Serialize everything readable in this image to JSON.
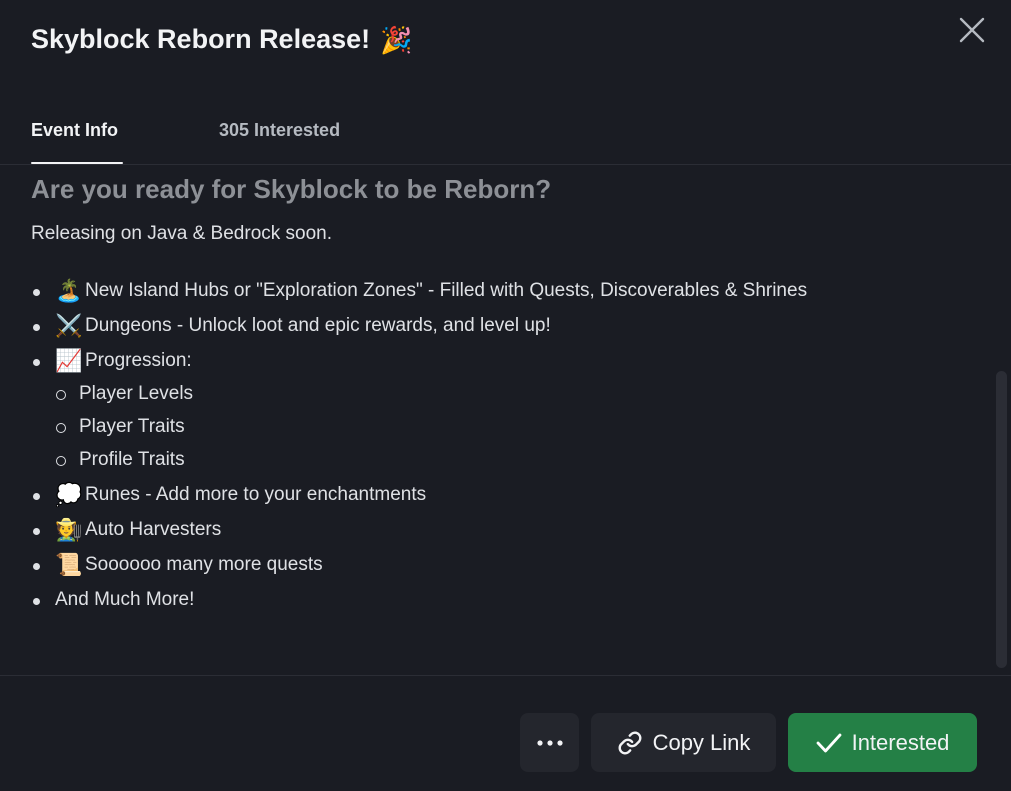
{
  "header": {
    "title": "Skyblock Reborn Release!",
    "title_emoji": "🎉"
  },
  "tabs": [
    {
      "label": "Event Info",
      "active": true
    },
    {
      "label": "305 Interested",
      "active": false
    }
  ],
  "content": {
    "heading": "Are you ready for Skyblock to be Reborn?",
    "intro": "Releasing on Java & Bedrock soon.",
    "features": [
      {
        "emoji": "🏝️",
        "text": "New Island Hubs or \"Exploration Zones\" - Filled with Quests, Discoverables & Shrines"
      },
      {
        "emoji": "⚔️",
        "text": "Dungeons - Unlock loot and epic rewards, and level up!"
      },
      {
        "emoji": "📈",
        "text": "Progression:"
      },
      {
        "emoji": "💭",
        "text": "Runes - Add more to your enchantments"
      },
      {
        "emoji": "🧑‍🌾",
        "text": "Auto Harvesters"
      },
      {
        "emoji": "📜",
        "text": "Soooooo many more quests"
      },
      {
        "emoji": "",
        "text": "And Much More!"
      }
    ],
    "progression_items": [
      "Player Levels",
      "Player Traits",
      "Profile Traits"
    ]
  },
  "footer": {
    "more_label": "...",
    "copy_link_label": "Copy Link",
    "interested_label": "Interested"
  },
  "colors": {
    "background": "#1a1c23",
    "interested_green": "#248046",
    "secondary_button": "#24262d"
  },
  "icons": {
    "close": "close-icon",
    "more": "more-dots-icon",
    "link": "link-icon",
    "check": "checkmark-icon"
  }
}
